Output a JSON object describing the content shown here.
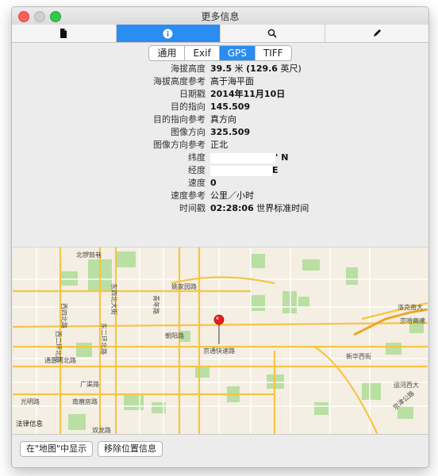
{
  "window": {
    "title": "更多信息"
  },
  "toolbar": {
    "tabs": [
      {
        "name": "document",
        "icon": "document-icon"
      },
      {
        "name": "info",
        "icon": "info-icon"
      },
      {
        "name": "search",
        "icon": "search-icon"
      },
      {
        "name": "edit",
        "icon": "pencil-icon"
      }
    ],
    "active_tab": "info"
  },
  "segments": {
    "items": [
      "通用",
      "Exif",
      "GPS",
      "TIFF"
    ],
    "active": "GPS"
  },
  "gps": {
    "rows": [
      {
        "label": "海拔高度",
        "value_bold": "39.5",
        "value_normal": " 米 ",
        "value_bold2": "(129.6",
        "value_tail": " 英尺)"
      },
      {
        "label": "海拔高度参考",
        "value": "高于海平面"
      },
      {
        "label": "日期戳",
        "value": "2014年11月10日"
      },
      {
        "label": "目的指向",
        "value": "145.509"
      },
      {
        "label": "目的指向参考",
        "value": "真方向"
      },
      {
        "label": "图像方向",
        "value": "325.509"
      },
      {
        "label": "图像方向参考",
        "value": "正北"
      },
      {
        "label": "纬度",
        "value_suffix": "' N"
      },
      {
        "label": "经度",
        "value_suffix": "E"
      },
      {
        "label": "速度",
        "value": "0"
      },
      {
        "label": "速度参考",
        "value": "公里／小时"
      },
      {
        "label": "时间戳",
        "value_bold": "02:28:06",
        "value_tail": " 世界标准时间"
      }
    ]
  },
  "map": {
    "labels": {
      "nanluogu": "北锣鼓巷",
      "xisi": "西四北路",
      "xierhuan": "西二环北路",
      "dongsi": "东四北大街",
      "dongerhuan": "东二环北路",
      "qingnian": "青年路",
      "yaojia": "姚家园路",
      "chaoyang": "朝阳路",
      "jingtong": "京通快速路",
      "xinhua": "新华西街",
      "guangqu": "广渠路",
      "nanmofang": "南磨房路",
      "guangming": "光明路",
      "shuanglong": "双龙路",
      "xiangheyuan": "通惠河北路",
      "jingshunan": "洛克南大",
      "jinghu": "京哈高速",
      "yunhe": "运河西大",
      "lawhint": "法律信息",
      "jingjin": "京津公路"
    },
    "pin_color": "#e02020",
    "park_color": "#b8dfa0",
    "road_color": "#f6c447"
  },
  "bottom": {
    "show_in_maps": "在\"地图\"中显示",
    "remove_location": "移除位置信息"
  },
  "colors": {
    "accent": "#2b8cf1"
  }
}
